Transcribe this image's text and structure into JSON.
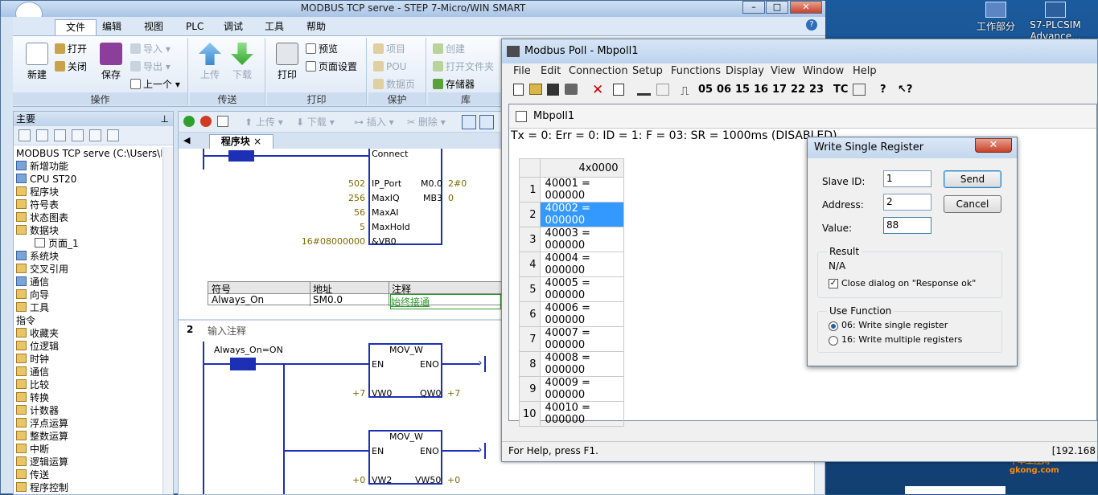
{
  "desktop": {
    "icons": [
      {
        "label": "工作部分"
      },
      {
        "label": "S7-PLCSIM Advance..."
      }
    ],
    "watermark": "中华工控网 gkong.com"
  },
  "step7": {
    "title": "MODBUS TCP serve - STEP 7-Micro/WIN SMART",
    "menu": [
      "文件",
      "编辑",
      "视图",
      "PLC",
      "调试",
      "工具",
      "帮助"
    ],
    "ribbon": {
      "new": "新建",
      "open": "打开",
      "close": "关闭",
      "save": "保存",
      "import": "导入",
      "export": "导出",
      "previous": "上一个",
      "group_ops": "操作",
      "upload": "上传",
      "download": "下载",
      "group_transfer": "传送",
      "print": "打印",
      "preview": "预览",
      "page_setup": "页面设置",
      "group_print": "打印",
      "project": "项目",
      "pou": "POU",
      "datablock": "数据页",
      "group_protect": "保护",
      "create": "创建",
      "open_folder": "打开文件夹",
      "memory": "存储器",
      "group_lib": "库"
    },
    "tree": {
      "header": "主要",
      "items": [
        "MODBUS TCP serve (C:\\Users\\Publ",
        "新增功能",
        "CPU ST20",
        "程序块",
        "符号表",
        "状态图表",
        "数据块",
        "页面_1",
        "系统块",
        "交叉引用",
        "通信",
        "向导",
        "工具",
        "指令",
        "收藏夹",
        "位逻辑",
        "时钟",
        "通信",
        "比较",
        "转换",
        "计数器",
        "浮点运算",
        "整数运算",
        "中断",
        "逻辑运算",
        "传送",
        "程序控制"
      ]
    },
    "editor": {
      "toolbar": {
        "upload": "上传",
        "download": "下载",
        "insert": "插入",
        "delete": "删除"
      },
      "tab": "程序块",
      "net1": {
        "block": "Connect",
        "pins": [
          "IP_Port",
          "MaxIQ",
          "MaxAI",
          "MaxHold",
          "VB0"
        ],
        "inputs": [
          "502",
          "256",
          "56",
          "5",
          "16#08000000"
        ],
        "outs": [
          {
            "pin": "M0.0",
            "val": "2#0"
          },
          {
            "pin": "MB3",
            "val": "0"
          }
        ]
      },
      "symtable": {
        "headers": [
          "符号",
          "地址",
          "注释"
        ],
        "row": [
          "Always_On",
          "SM0.0",
          "始终接通"
        ]
      },
      "net2": {
        "num": "2",
        "comment": "输入注释",
        "contact": "Always_On=ON",
        "mov1": {
          "name": "MOV_W",
          "en": "EN",
          "eno": "ENO",
          "in_pin": "VW0",
          "out_pin": "QW0",
          "in_val": "+7",
          "out_val": "+7"
        },
        "mov2": {
          "name": "MOV_W",
          "en": "EN",
          "eno": "ENO",
          "in_pin": "VW2",
          "out_pin": "VW50",
          "in_val": "+0",
          "out_val": "+0"
        }
      }
    }
  },
  "mp": {
    "title": "Modbus Poll - Mbpoll1",
    "menu": [
      "File",
      "Edit",
      "Connection",
      "Setup",
      "Functions",
      "Display",
      "View",
      "Window",
      "Help"
    ],
    "toolbar_codes": [
      "05",
      "06",
      "15",
      "16",
      "17",
      "22",
      "23",
      "TC"
    ],
    "child_title": "Mbpoll1",
    "status_line": "Tx = 0: Err = 0: ID = 1: F = 03: SR = 1000ms  (DISABLED)",
    "col_header": "4x0000",
    "rows": [
      {
        "n": "1",
        "v": "40001 = 000000"
      },
      {
        "n": "2",
        "v": "40002 = 000000"
      },
      {
        "n": "3",
        "v": "40003 = 000000"
      },
      {
        "n": "4",
        "v": "40004 = 000000"
      },
      {
        "n": "5",
        "v": "40005 = 000000"
      },
      {
        "n": "6",
        "v": "40006 = 000000"
      },
      {
        "n": "7",
        "v": "40007 = 000000"
      },
      {
        "n": "8",
        "v": "40008 = 000000"
      },
      {
        "n": "9",
        "v": "40009 = 000000"
      },
      {
        "n": "10",
        "v": "40010 = 000000"
      }
    ],
    "statusbar": "For Help, press F1.",
    "statusbar_right": "[192.168"
  },
  "dialog": {
    "title": "Write Single Register",
    "slave_label": "Slave ID:",
    "slave_value": "1",
    "address_label": "Address:",
    "address_value": "2",
    "value_label": "Value:",
    "value_value": "88",
    "send": "Send",
    "cancel": "Cancel",
    "result_title": "Result",
    "result_value": "N/A",
    "close_on_ok": "Close dialog on \"Response ok\"",
    "use_function": "Use Function",
    "fn06": "06: Write single register",
    "fn16": "16: Write multiple registers"
  }
}
